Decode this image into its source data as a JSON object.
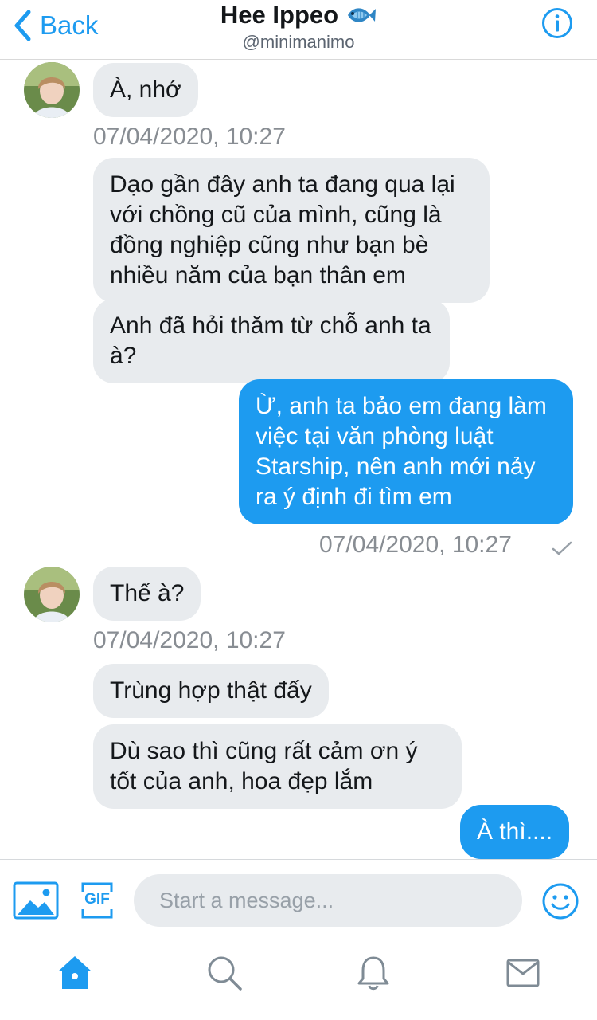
{
  "header": {
    "back_label": "Back",
    "title": "Hee Ippeo",
    "title_icon": "fish-icon",
    "handle": "@minimanimo",
    "info_icon": "info-icon"
  },
  "colors": {
    "accent": "#1d9bf0",
    "incoming_bubble": "#e8ebee",
    "outgoing_bubble": "#1d9bf0",
    "timestamp": "#888d93"
  },
  "messages": [
    {
      "from": "them",
      "text": "À, nhớ"
    },
    {
      "from": "them",
      "text": "Dạo gần đây anh ta đang qua lại với chồng cũ của mình, cũng là đồng nghiệp cũng như bạn bè nhiều năm của bạn thân em"
    },
    {
      "from": "them",
      "text": "Anh đã hỏi thăm từ chỗ anh ta à?"
    },
    {
      "from": "me",
      "text": "Ừ, anh ta bảo em đang làm việc tại văn phòng luật Starship, nên anh mới nảy ra ý định đi tìm em"
    },
    {
      "from": "them",
      "text": "Thế à?"
    },
    {
      "from": "them",
      "text": "Trùng hợp thật đấy"
    },
    {
      "from": "them",
      "text": "Dù sao thì cũng rất cảm ơn ý tốt của anh, hoa đẹp lắm"
    },
    {
      "from": "me",
      "text": "À thì...."
    }
  ],
  "timestamps": [
    "07/04/2020, 10:27",
    "07/04/2020, 10:27",
    "07/04/2020, 10:27"
  ],
  "composer": {
    "placeholder": "Start a message...",
    "media_icon": "image-icon",
    "gif_label": "GIF",
    "emoji_icon": "emoji-icon"
  },
  "tabbar": {
    "items": [
      "home-icon",
      "search-icon",
      "notifications-icon",
      "messages-icon"
    ],
    "active": "home-icon"
  }
}
